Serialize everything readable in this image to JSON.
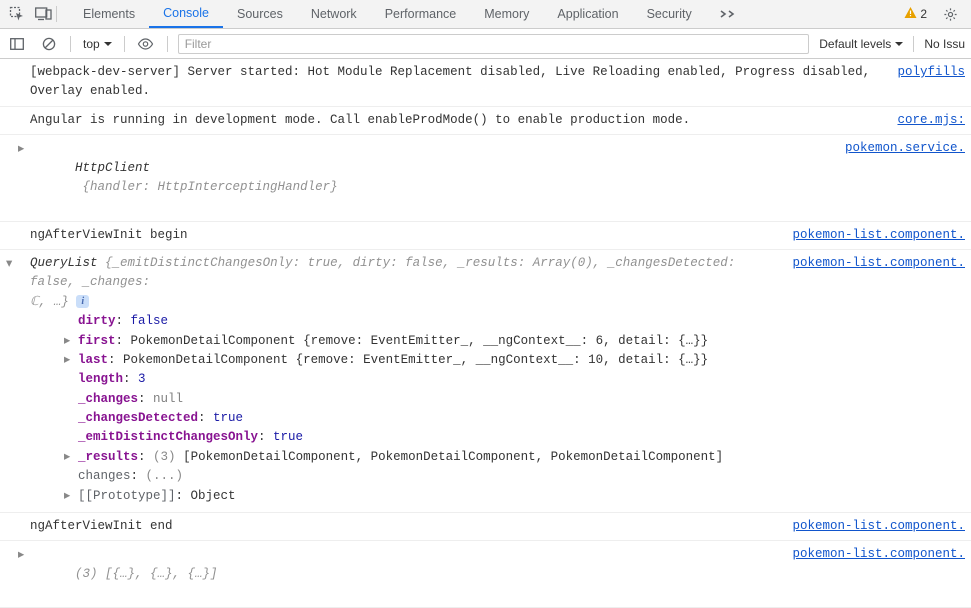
{
  "tabs": [
    "Elements",
    "Console",
    "Sources",
    "Network",
    "Performance",
    "Memory",
    "Application",
    "Security"
  ],
  "activeTab": "Console",
  "warningCount": "2",
  "toolbar": {
    "context": "top",
    "filterPlaceholder": "Filter",
    "levels": "Default levels",
    "issues": "No Issu"
  },
  "logs": {
    "l0": {
      "msg": "[webpack-dev-server] Server started: Hot Module Replacement disabled, Live Reloading enabled, Progress disabled, Overlay enabled.",
      "src": "polyfills"
    },
    "l1": {
      "msg": "Angular is running in development mode. Call enableProdMode() to enable production mode.",
      "src": "core.mjs:"
    },
    "l2": {
      "class": "HttpClient",
      "preview": "handler: HttpInterceptingHandler",
      "src": "pokemon.service."
    },
    "l3": {
      "msg": "ngAfterViewInit begin",
      "src": "pokemon-list.component."
    },
    "l4": {
      "src": "pokemon-list.component.",
      "class": "QueryList",
      "summary": {
        "p1k": "_emitDistinctChangesOnly",
        "p1v": "true",
        "p2k": "dirty",
        "p2v": "false",
        "p3k": "_results",
        "p3v": "Array(0)",
        "p4k": "_changesDetected",
        "p4v": "false",
        "p5k": "_changes",
        "tail": "ℂ, …}"
      },
      "props": {
        "dirty": {
          "k": "dirty",
          "v": "false"
        },
        "first": {
          "k": "first",
          "class": "PokemonDetailComponent",
          "preview": "{remove: EventEmitter_, __ngContext__: 6, detail: {…}}"
        },
        "last": {
          "k": "last",
          "class": "PokemonDetailComponent",
          "preview": "{remove: EventEmitter_, __ngContext__: 10, detail: {…}}"
        },
        "length": {
          "k": "length",
          "v": "3"
        },
        "_changes": {
          "k": "_changes",
          "v": "null"
        },
        "_changesDetected": {
          "k": "_changesDetected",
          "v": "true"
        },
        "_emitDistinct": {
          "k": "_emitDistinctChangesOnly",
          "v": "true"
        },
        "_results": {
          "k": "_results",
          "count": "(3)",
          "preview": "[PokemonDetailComponent, PokemonDetailComponent, PokemonDetailComponent]"
        },
        "changes": {
          "k": "changes",
          "v": "(...)"
        },
        "proto": {
          "k": "[[Prototype]]",
          "v": "Object"
        }
      }
    },
    "l5": {
      "msg": "ngAfterViewInit end",
      "src": "pokemon-list.component."
    },
    "l6": {
      "preview": "(3) [{…}, {…}, {…}]",
      "src": "pokemon-list.component."
    }
  }
}
